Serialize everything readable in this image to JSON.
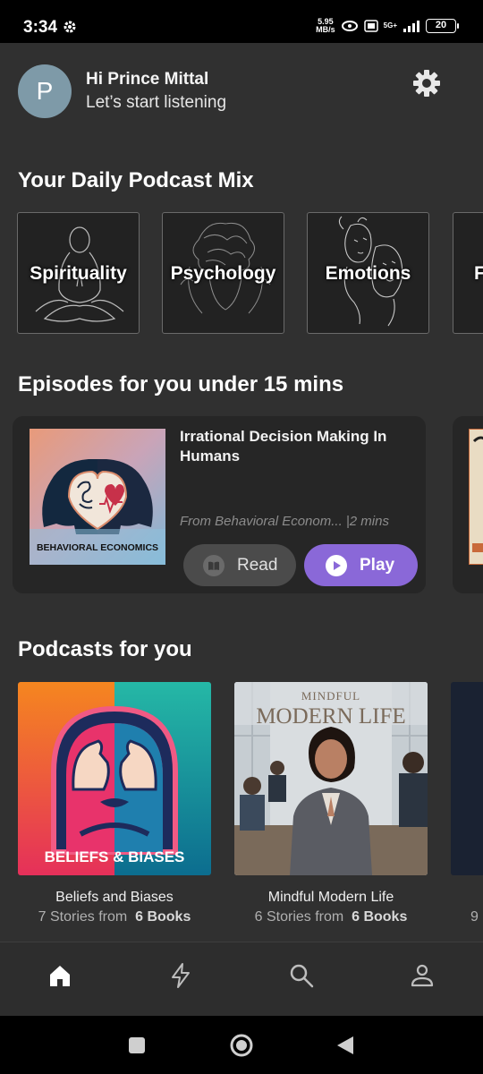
{
  "status_bar": {
    "time": "3:34",
    "net_speed_value": "5.95",
    "net_speed_unit": "MB/s",
    "network": "5G+",
    "battery": "20"
  },
  "header": {
    "avatar_initial": "P",
    "greeting": "Hi Prince Mittal",
    "subtitle": "Let’s start listening",
    "settings_icon": "gear-icon"
  },
  "daily_mix": {
    "title": "Your Daily Podcast Mix",
    "items": [
      {
        "label": "Spirituality"
      },
      {
        "label": "Psychology"
      },
      {
        "label": "Emotions"
      },
      {
        "label": "F"
      }
    ]
  },
  "episodes": {
    "title": "Episodes for you under 15 mins",
    "items": [
      {
        "title": "Irrational Decision Making In Humans",
        "meta": "From Behavioral Econom... |2 mins",
        "art_caption": "BEHAVIORAL ECONOMICS",
        "read_label": "Read",
        "play_label": "Play"
      }
    ]
  },
  "podcasts": {
    "title": "Podcasts for you",
    "items": [
      {
        "name": "Beliefs and Biases",
        "stories": "7 Stories from",
        "books": "6 Books",
        "art_caption": "BELIEFS & BIASES"
      },
      {
        "name": "Mindful Modern Life",
        "stories": "6 Stories from",
        "books": "6 Books",
        "art_line1": "MINDFUL",
        "art_line2": "MODERN LIFE"
      },
      {
        "stories_partial": "9"
      }
    ]
  },
  "bottom_nav": {
    "items": [
      {
        "icon": "home-icon",
        "active": true
      },
      {
        "icon": "lightning-icon",
        "active": false
      },
      {
        "icon": "search-icon",
        "active": false
      },
      {
        "icon": "profile-icon",
        "active": false
      }
    ]
  },
  "colors": {
    "background": "#303030",
    "card": "#262626",
    "accent": "#8a68d8",
    "muted_text": "#8c8c8c"
  }
}
